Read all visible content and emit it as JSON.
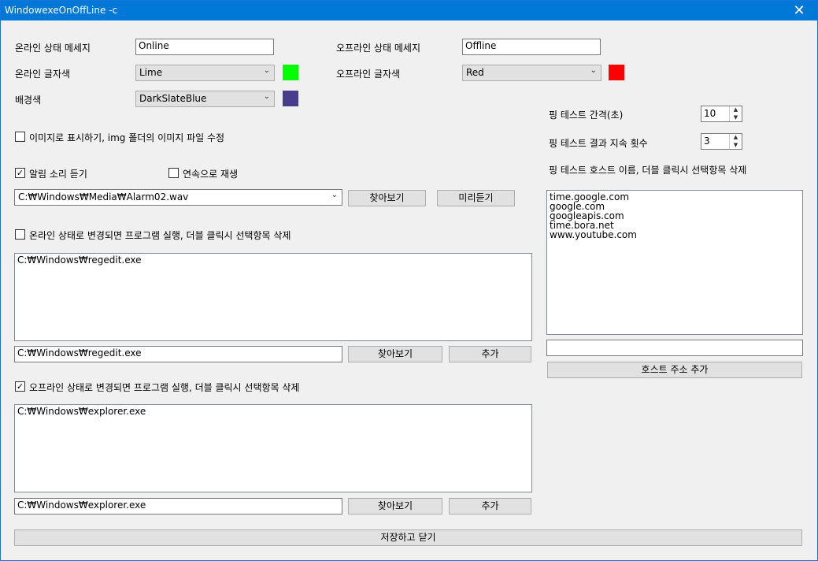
{
  "window": {
    "title": "WindowexeOnOffLine -c",
    "close_glyph": "✕"
  },
  "online": {
    "status_label": "온라인 상태 메세지",
    "status_value": "Online",
    "color_label": "온라인 글자색",
    "color_value": "Lime",
    "swatch_color": "#00ff00"
  },
  "offline": {
    "status_label": "오프라인 상태 메세지",
    "status_value": "Offline",
    "color_label": "오프라인 글자색",
    "color_value": "Red",
    "swatch_color": "#ff0000"
  },
  "background": {
    "label": "배경색",
    "value": "DarkSlateBlue",
    "swatch_color": "#483d8b"
  },
  "image_option": {
    "label": "이미지로 표시하기, img 폴더의 이미지 파일 수정",
    "checked": false
  },
  "sound": {
    "alarm_label": "알림 소리 듣기",
    "alarm_checked": true,
    "continuous_label": "연속으로 재생",
    "continuous_checked": false,
    "path": "C:₩Windows₩Media₩Alarm02.wav",
    "browse_label": "찾아보기",
    "preview_label": "미리듣기"
  },
  "online_program": {
    "label": "온라인 상태로 변경되면 프로그램 실행, 더블 클릭시 선택항목 삭제",
    "checked": false,
    "items": [
      "C:₩Windows₩regedit.exe"
    ],
    "input_value": "C:₩Windows₩regedit.exe",
    "browse_label": "찾아보기",
    "add_label": "추가"
  },
  "offline_program": {
    "label": "오프라인 상태로 변경되면 프로그램 실행, 더블 클릭시 선택항목 삭제",
    "checked": true,
    "items": [
      "C:₩Windows₩explorer.exe"
    ],
    "input_value": "C:₩Windows₩explorer.exe",
    "browse_label": "찾아보기",
    "add_label": "추가"
  },
  "ping": {
    "interval_label": "핑 테스트 간격(초)",
    "interval_value": "10",
    "persist_label": "핑 테스트 결과 지속 횟수",
    "persist_value": "3",
    "hosts_label": "핑 테스트 호스트 이름, 더블 클릭시 선택항목 삭제",
    "hosts": [
      "time.google.com",
      "google.com",
      "googleapis.com",
      "time.bora.net",
      "www.youtube.com"
    ],
    "host_input_value": "",
    "add_host_label": "호스트 주소 추가"
  },
  "save_close_label": "저장하고 닫기",
  "icons": {
    "dropdown": "chevron-down-icon",
    "check": "checkmark-icon",
    "close": "close-icon"
  }
}
